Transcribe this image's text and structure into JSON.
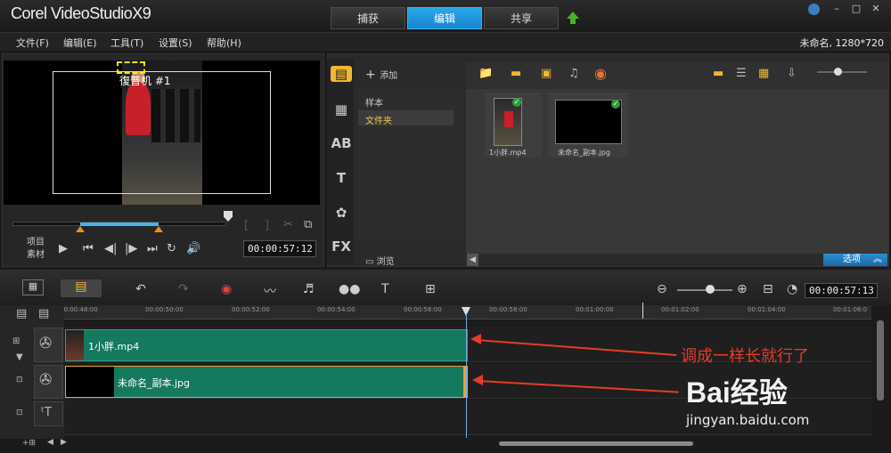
{
  "app": {
    "logo": "Corel VideoStudioX9"
  },
  "tabs": [
    {
      "label": "捕获"
    },
    {
      "label": "编辑"
    },
    {
      "label": "共享"
    }
  ],
  "menu": [
    "文件(F)",
    "编辑(E)",
    "工具(T)",
    "设置(S)",
    "帮助(H)"
  ],
  "project_info": "未命名, 1280*720",
  "preview": {
    "overlay_text": "復普机 #1",
    "mode_project": "项目",
    "mode_clip": "素材",
    "timecode": "00:00:57:12"
  },
  "library": {
    "add_label": "添加",
    "tree": [
      "样本",
      "文件夹"
    ],
    "browse_label": "浏览",
    "options_label": "选项",
    "media": [
      {
        "name": "1小胖.mp4"
      },
      {
        "name": "未命名_副本.jpg"
      }
    ]
  },
  "timeline": {
    "timecode": "00:00:57:13",
    "ruler": [
      "00:00:48:00",
      "00:00:50:00",
      "00:00:52:00",
      "00:00:54:00",
      "00:00:56:00",
      "00:00:58:00",
      "00:01:00:00",
      "00:01:02:00",
      "00:01:04:00",
      "00:01:06:0"
    ],
    "clips": [
      {
        "name": "1小胖.mp4"
      },
      {
        "name": "未命名_副本.jpg"
      }
    ]
  },
  "annotation": "调成一样长就行了",
  "watermark": {
    "brand": "Bai经验",
    "url": "jingyan.baidu.com"
  },
  "colors": {
    "accent": "#1e90d8",
    "clip": "#15795f",
    "annotation": "#e63b2a"
  }
}
